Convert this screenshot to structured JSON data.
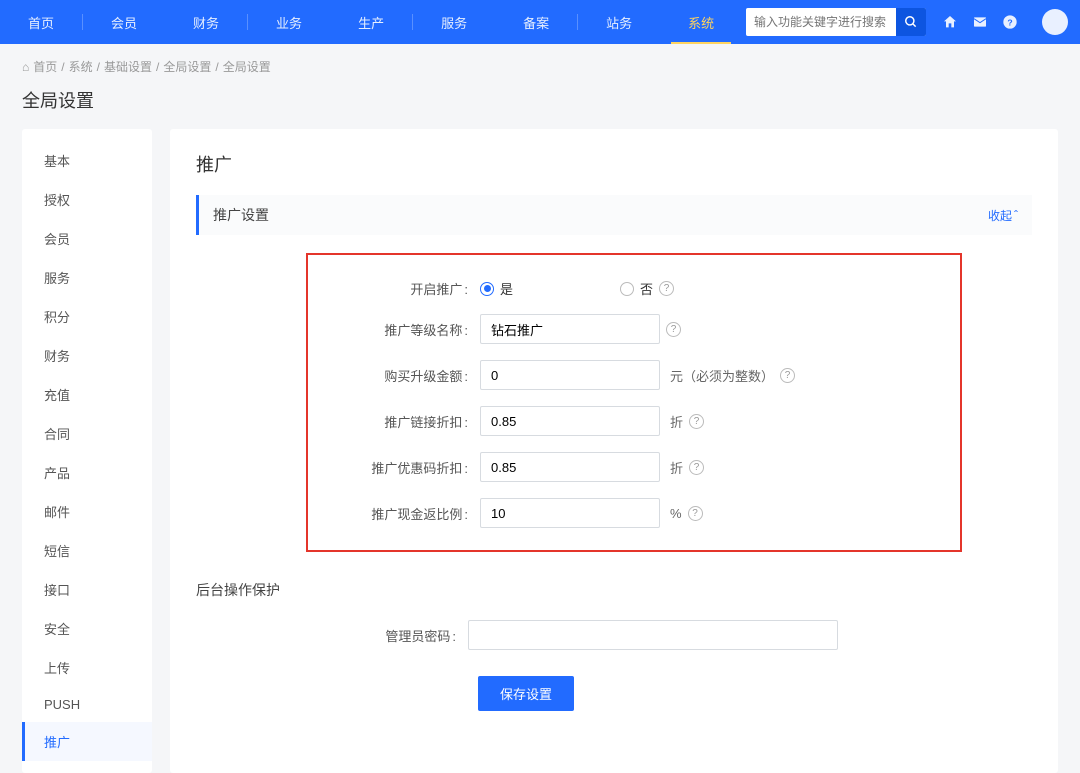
{
  "nav": {
    "items": [
      "首页",
      "会员",
      "财务",
      "业务",
      "生产",
      "服务",
      "备案",
      "站务",
      "系统"
    ],
    "active_index": 8
  },
  "search": {
    "placeholder": "输入功能关键字进行搜索"
  },
  "breadcrumb": {
    "home_icon": "⌂",
    "items": [
      "首页",
      "系统",
      "基础设置",
      "全局设置",
      "全局设置"
    ]
  },
  "page_title": "全局设置",
  "sidebar": {
    "items": [
      "基本",
      "授权",
      "会员",
      "服务",
      "积分",
      "财务",
      "充值",
      "合同",
      "产品",
      "邮件",
      "短信",
      "接口",
      "安全",
      "上传",
      "PUSH",
      "推广"
    ],
    "active_index": 15
  },
  "main": {
    "title": "推广",
    "section_title": "推广设置",
    "collapse_label": "收起",
    "form": {
      "enable_label": "开启推广",
      "enable_yes": "是",
      "enable_no": "否",
      "level_label": "推广等级名称",
      "level_value": "钻石推广",
      "upgrade_label": "购买升级金额",
      "upgrade_value": "0",
      "upgrade_suffix": "元（必须为整数）",
      "link_label": "推广链接折扣",
      "link_value": "0.85",
      "link_suffix": "折",
      "coupon_label": "推广优惠码折扣",
      "coupon_value": "0.85",
      "coupon_suffix": "折",
      "cashback_label": "推广现金返比例",
      "cashback_value": "10",
      "cashback_suffix": "%"
    },
    "protect": {
      "title": "后台操作保护",
      "pwd_label": "管理员密码",
      "pwd_value": ""
    },
    "save_button": "保存设置"
  }
}
